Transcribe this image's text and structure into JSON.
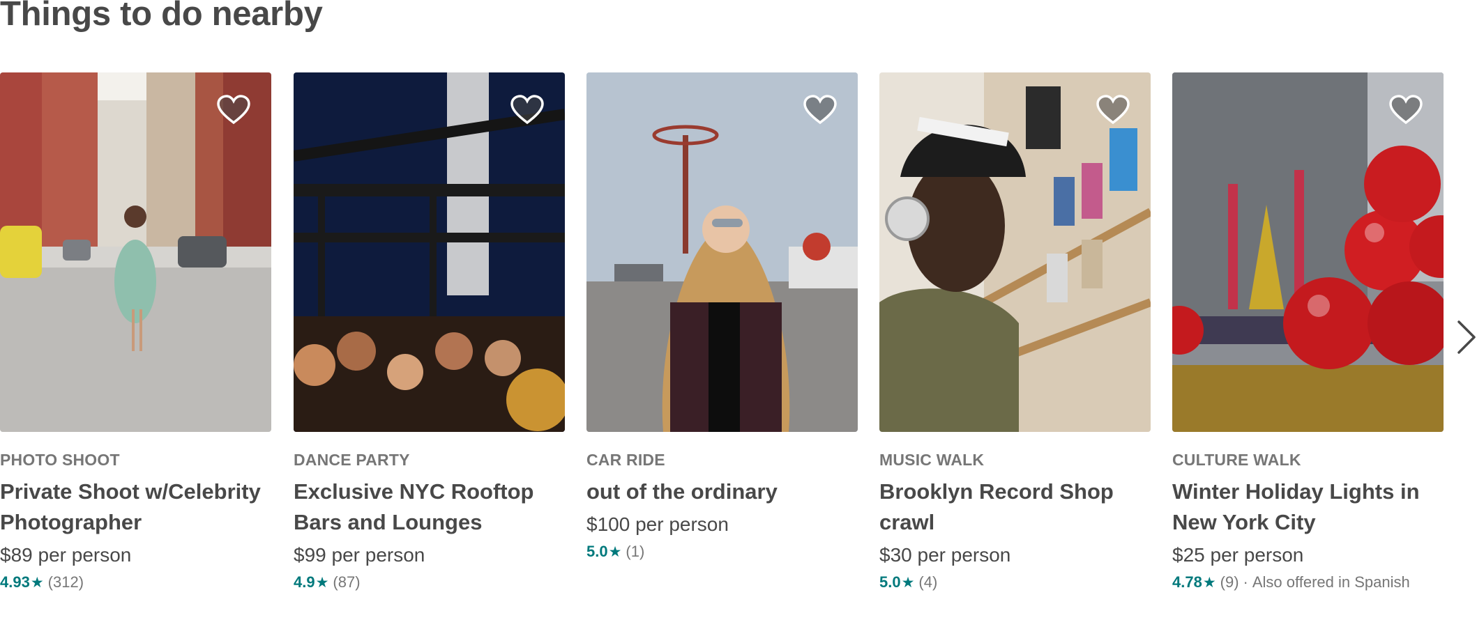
{
  "page": {
    "title": "Things to do nearby"
  },
  "experiences": [
    {
      "category": "PHOTO SHOOT",
      "title": "Private Shoot w/Celebrity Photographer",
      "price_amount": "$89",
      "price_unit": "per person",
      "rating": "4.93",
      "star": "★",
      "reviews": "(312)",
      "extra": ""
    },
    {
      "category": "DANCE PARTY",
      "title": "Exclusive NYC Rooftop Bars and Lounges",
      "price_amount": "$99",
      "price_unit": "per person",
      "rating": "4.9",
      "star": "★",
      "reviews": "(87)",
      "extra": ""
    },
    {
      "category": "CAR RIDE",
      "title": "out of the ordinary",
      "price_amount": "$100",
      "price_unit": "per person",
      "rating": "5.0",
      "star": "★",
      "reviews": "(1)",
      "extra": ""
    },
    {
      "category": "MUSIC WALK",
      "title": "Brooklyn Record Shop crawl",
      "price_amount": "$30",
      "price_unit": "per person",
      "rating": "5.0",
      "star": "★",
      "reviews": "(4)",
      "extra": ""
    },
    {
      "category": "CULTURE WALK",
      "title": "Winter Holiday Lights in New York City",
      "price_amount": "$25",
      "price_unit": "per person",
      "rating": "4.78",
      "star": "★",
      "reviews": "(9)",
      "separator": "·",
      "extra": "Also offered in Spanish"
    }
  ],
  "icons": {
    "save": "heart-icon",
    "next": "chevron-right-icon"
  },
  "colors": {
    "rating": "#00797c",
    "text": "#484848",
    "muted": "#767676"
  }
}
